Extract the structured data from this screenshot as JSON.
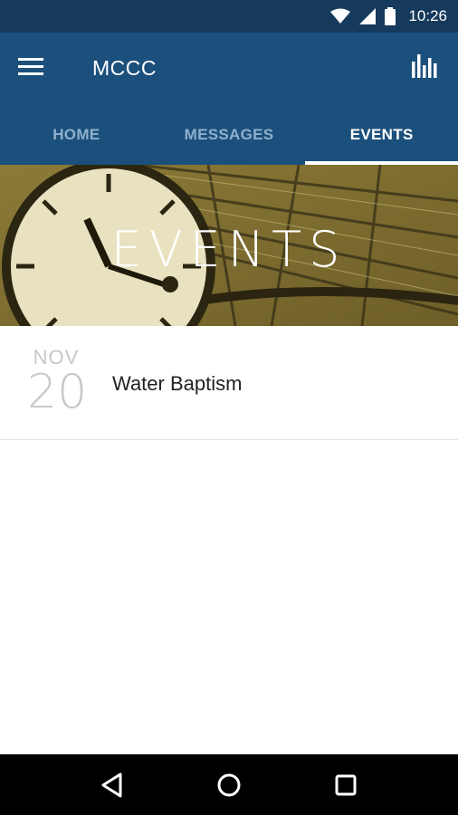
{
  "status_bar": {
    "time": "10:26",
    "icons": [
      "wifi-icon",
      "cell-signal-icon",
      "battery-icon"
    ]
  },
  "app_bar": {
    "title": "MCCC",
    "menu_icon": "hamburger-menu-icon",
    "action_icon": "bar-chart-icon",
    "background": "#1c507c"
  },
  "tabs": [
    {
      "label": "HOME",
      "active": false
    },
    {
      "label": "MESSAGES",
      "active": false
    },
    {
      "label": "EVENTS",
      "active": true
    }
  ],
  "hero": {
    "title": "EVENTS",
    "image": "station-clock-photo"
  },
  "events": [
    {
      "month": "NOV",
      "day": "20",
      "title": "Water Baptism"
    }
  ],
  "nav_bar": {
    "icons": [
      "back-icon",
      "home-icon",
      "recents-icon"
    ]
  },
  "colors": {
    "status_bar": "#153a5c",
    "primary": "#1c507c",
    "tab_inactive": "#8fb0cc",
    "hero_tint": "#7a6a30"
  }
}
